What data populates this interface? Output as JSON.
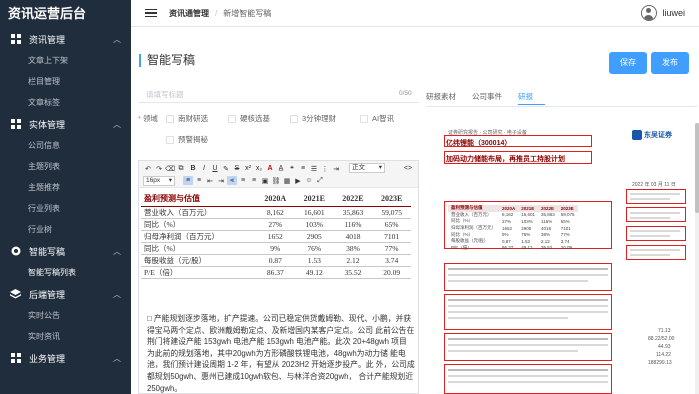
{
  "app": {
    "title": "资讯运营后台"
  },
  "sidebar": {
    "groups": [
      {
        "label": "资讯管理",
        "icon": "grid-icon",
        "items": [
          "文章上下架",
          "栏目管理",
          "文章标签"
        ]
      },
      {
        "label": "实体管理",
        "icon": "grid-icon",
        "items": [
          "公司信息",
          "主题列表",
          "主题推荐",
          "行业列表",
          "行业树"
        ]
      },
      {
        "label": "智能写稿",
        "icon": "target-icon",
        "items": [
          "智能写稿列表"
        ]
      },
      {
        "label": "后端管理",
        "icon": "layers-icon",
        "items": [
          "实时公告",
          "实时资讯"
        ]
      },
      {
        "label": "业务管理",
        "icon": "grid-icon",
        "items": []
      }
    ]
  },
  "topbar": {
    "breadcrumb": [
      "资讯通管理",
      "新增智能写稿"
    ],
    "username": "liuwei"
  },
  "main": {
    "page_title": "智能写稿",
    "save_label": "保存",
    "publish_label": "发布",
    "title_placeholder": "请填写标题",
    "title_counter": "0/50",
    "tag_label": "领域",
    "tags": [
      "南财研选",
      "硬核选基",
      "3分钟理财",
      "AI智讯",
      "预警揭秘"
    ],
    "editor": {
      "style_select": "正文",
      "size_select": "16px",
      "table_title": "盈利预测与估值",
      "table_columns": [
        "2020A",
        "2021E",
        "2022E",
        "2023E"
      ],
      "table_rows": [
        {
          "label": "营业收入（百万元）",
          "values": [
            "8,162",
            "16,601",
            "35,863",
            "59,075"
          ]
        },
        {
          "label": "同比（%）",
          "values": [
            "27%",
            "103%",
            "116%",
            "65%"
          ]
        },
        {
          "label": "归母净利润（百万元）",
          "values": [
            "1652",
            "2905",
            "4018",
            "7101"
          ]
        },
        {
          "label": "同比（%）",
          "values": [
            "9%",
            "76%",
            "38%",
            "77%"
          ]
        },
        {
          "label": "每股收益（元/股）",
          "values": [
            "0.87",
            "1.53",
            "2.12",
            "3.74"
          ]
        },
        {
          "label": "P/E（倍）",
          "values": [
            "86.37",
            "49.12",
            "35.52",
            "20.09"
          ]
        }
      ],
      "paragraph": "□ 产能规划逐步落地，扩产提速。公司已稳定供货戴姆勒、现代、小鹏，并获得宝马两个定点、欧洲戴姆勒定点、及新增国内某客户定点。公司 此前公告在荆门将建设产能 153gwh 电池产能 153gwh 电池产能。此次 20+48gwh 项目 为此前的规划落地，其中20gwh为方形磷酸铁锂电池，48gwh为动力储 能电池，我们预计建设周期 1-2 年，有望从 2023H2 开始逐步投产。此 外，公司成都规划50gwh、惠州已建成10gwh软包、与林洋合资20gwh， 合计产能规划近250gwh。"
    },
    "tabs": [
      "研报素材",
      "公司事件",
      "研报"
    ],
    "active_tab": "研报",
    "doc": {
      "header": "证券研究报告 · 公司研究 · 电子设备",
      "company": "亿纬锂能（300014）",
      "headline": "加码动力储能布局，再推员工持股计划",
      "logo_text": "东吴证券",
      "date": "2022 年 03 月 11 日",
      "mini_columns": [
        "盈利预测与估值",
        "2020A",
        "2021E",
        "2022E",
        "2023E"
      ],
      "mini_rows": [
        [
          "营业收入（百万元）",
          "8,162",
          "16,601",
          "35,863",
          "59,075"
        ],
        [
          "同比（%）",
          "27%",
          "103%",
          "116%",
          "65%"
        ],
        [
          "归母净利润（百万元）",
          "1652",
          "2905",
          "4018",
          "7101"
        ],
        [
          "同比（%）",
          "9%",
          "76%",
          "38%",
          "77%"
        ],
        [
          "每股收益（元/股）",
          "0.87",
          "1.53",
          "2.12",
          "3.74"
        ],
        [
          "P/E（倍）",
          "86.37",
          "49.12",
          "35.52",
          "20.09"
        ]
      ],
      "side_numbers": [
        "71.13",
        "88.22/52.00",
        "44.93",
        "114.22",
        "188299.13"
      ]
    }
  },
  "colors": {
    "sidebar_bg": "#1f2d3d",
    "accent": "#409eff",
    "doc_red": "#8b0000",
    "highlight_red": "#e02020"
  }
}
